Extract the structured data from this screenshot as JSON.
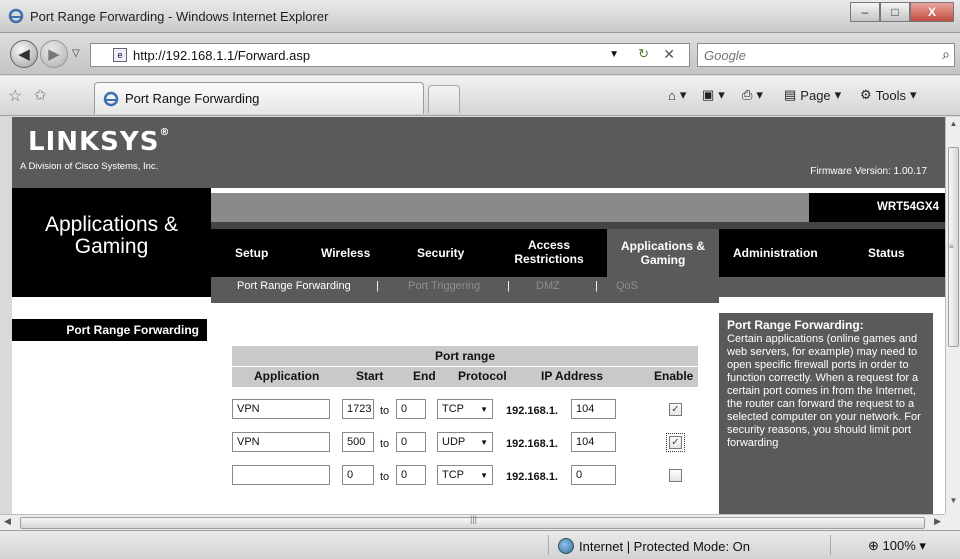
{
  "window": {
    "title": "Port Range Forwarding - Windows Internet Explorer",
    "min": "–",
    "max": "□",
    "close": "X"
  },
  "address_bar": {
    "url": "http://192.168.1.1/Forward.asp"
  },
  "search": {
    "placeholder": "Google"
  },
  "tab": {
    "label": "Port Range Forwarding"
  },
  "commands": {
    "page": "Page",
    "tools": "Tools"
  },
  "status": {
    "zone": "Internet | Protected Mode: On",
    "zoom": "100%"
  },
  "router": {
    "brand": "LINKSYS",
    "reg": "®",
    "tagline": "A Division of Cisco Systems, Inc.",
    "firmware": "Firmware Version: 1.00.17",
    "model": "WRT54GX4",
    "section_title": "Applications & Gaming",
    "tabs": [
      {
        "label": "Setup"
      },
      {
        "label": "Wireless"
      },
      {
        "label": "Security"
      },
      {
        "label": "Access Restrictions"
      },
      {
        "label": "Applications & Gaming"
      },
      {
        "label": "Administration"
      },
      {
        "label": "Status"
      }
    ],
    "subtabs": [
      {
        "label": "Port Range Forwarding"
      },
      {
        "label": "Port Triggering"
      },
      {
        "label": "DMZ"
      },
      {
        "label": "QoS"
      }
    ],
    "left_label": "Port Range Forwarding",
    "table": {
      "group_header": "Port range",
      "headers": [
        "Application",
        "Start",
        "End",
        "Protocol",
        "IP Address",
        "Enable"
      ],
      "to_label": "to",
      "ip_prefix": "192.168.1.",
      "rows": [
        {
          "application": "VPN",
          "start": "1723",
          "end": "0",
          "protocol": "TCP",
          "ip": "104",
          "enabled": true
        },
        {
          "application": "VPN",
          "start": "500",
          "end": "0",
          "protocol": "UDP",
          "ip": "104",
          "enabled": true
        },
        {
          "application": "",
          "start": "0",
          "end": "0",
          "protocol": "TCP",
          "ip": "0",
          "enabled": false
        }
      ]
    },
    "help": {
      "title": "Port Range Forwarding:",
      "body": "Certain applications (online games and web servers, for example) may need to open specific firewall ports in order to function correctly. When a request for a certain port comes in from the Internet, the router can forward the request to a selected computer on your network. For security reasons, you should limit port forwarding"
    }
  }
}
